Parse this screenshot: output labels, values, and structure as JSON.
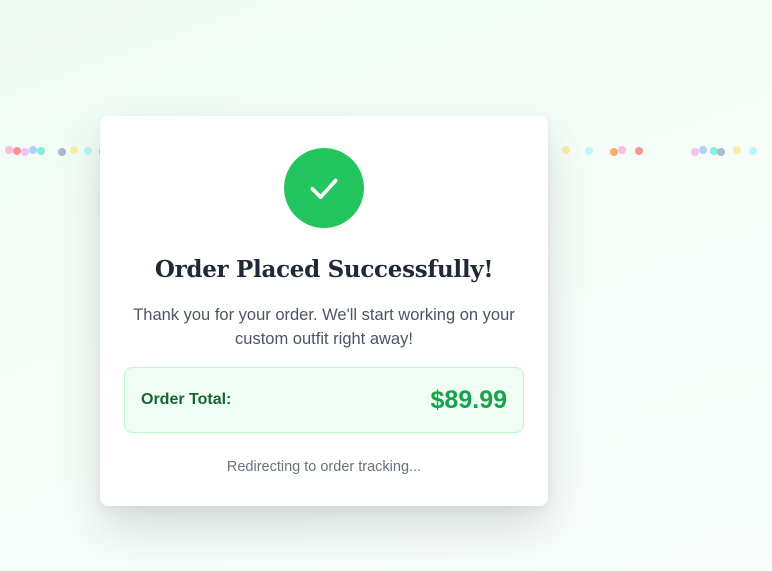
{
  "modal": {
    "title": "Order Placed Successfully!",
    "message": "Thank you for your order. We'll start working on your custom outfit right away!",
    "total_label": "Order Total:",
    "total_value": "$89.99",
    "redirect_text": "Redirecting to order tracking...",
    "icon": "check-icon"
  },
  "colors": {
    "success": "#22c55e",
    "total_value": "#16a34a",
    "total_label": "#166534",
    "total_box_bg": "#f0fdf4",
    "total_box_border": "#bbf7d0",
    "confetti": [
      "#f9a8d4",
      "#f0abfc",
      "#5eead4",
      "#fde68a",
      "#fb923c",
      "#f87171",
      "#93c5fd",
      "#94a3b8",
      "#a5f3fc"
    ]
  }
}
